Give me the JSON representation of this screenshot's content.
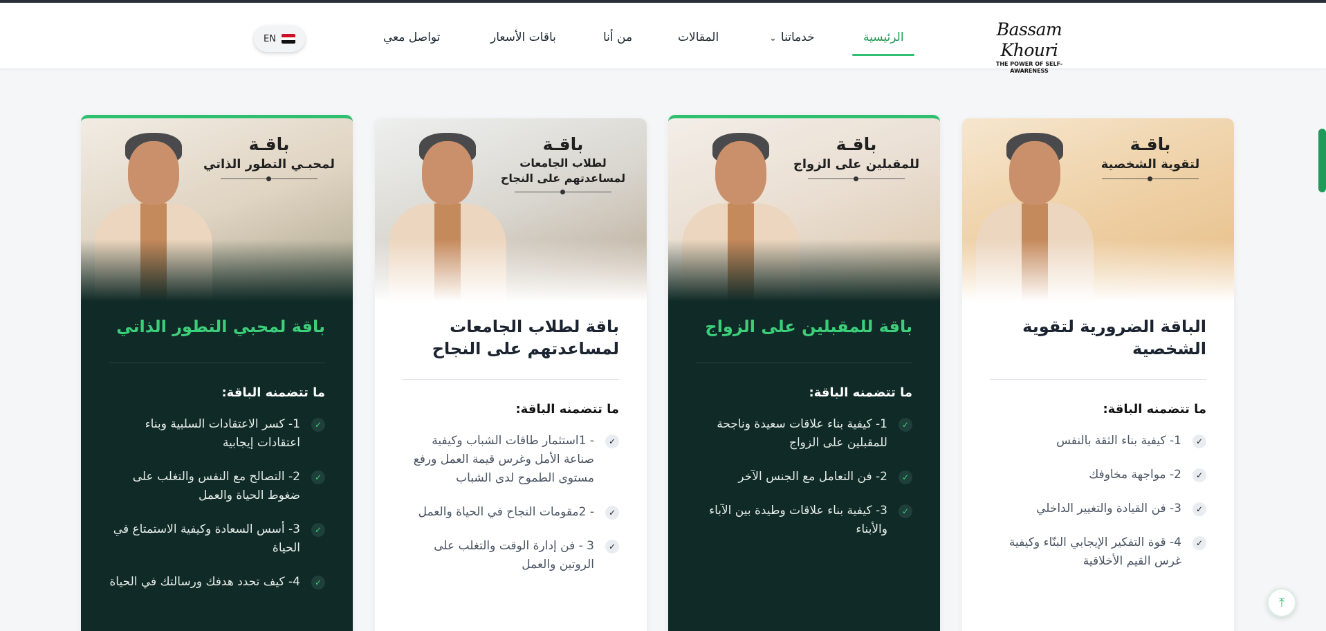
{
  "header": {
    "logo_script": "Bassam Khouri",
    "logo_tagline": "THE POWER OF SELF-AWARENESS",
    "nav": {
      "home": "الرئيسية",
      "services": "خدماتنا",
      "articles": "المقالات",
      "about": "من أنا",
      "pricing": "باقات الأسعار",
      "contact": "تواصل معي"
    },
    "lang_label": "EN"
  },
  "cards": [
    {
      "overlay_title": "باقـة",
      "overlay_sub": "لتقوية الشخصية",
      "title": "الباقة الضرورية لتقوية الشخصية",
      "includes": "ما تتضمنه الباقة:",
      "features": [
        "1- كيفية بناء الثقة بالنفس",
        "2- مواجهة مخاوفك",
        "3- فن القيادة والتغيير الداخلي",
        "4- قوة التفكير الإيجابي البنّاء وكيفية غرس القيم الأخلاقية"
      ]
    },
    {
      "overlay_title": "باقـة",
      "overlay_sub": "للمقبلين على الزواج",
      "title": "باقة للمقبلين على الزواج",
      "includes": "ما تتضمنه الباقة:",
      "features": [
        "1- كيفية بناء علاقات سعيدة وناجحة للمقبلين على الزواج",
        "2- فن التعامل مع الجنس الآخر",
        "3- كيفية بناء علاقات وطيدة بين الآباء والأبناء"
      ]
    },
    {
      "overlay_title": "باقـة",
      "overlay_sub": "لطلاب الجامعات لمساعدتهم على النجاح",
      "title": "باقة لطلاب الجامعات لمساعدتهم على النجاح",
      "includes": "ما تتضمنه الباقة:",
      "features": [
        "- 1استثمار طاقات الشباب وكيفية صناعة الأمل وغرس قيمة العمل ورفع مستوى الطموح لدى الشباب",
        "- 2مقومات النجاح في الحياة والعمل",
        "3 - فن إدارة الوقت والتغلب على الروتين والعمل"
      ]
    },
    {
      "overlay_title": "باقـة",
      "overlay_sub": "لمحبـي التطور الذاتي",
      "title": "باقة لمحبي التطور الذاتي",
      "includes": "ما تتضمنه الباقة:",
      "features": [
        "1- كسر الاعتقادات السلبية وبناء اعتقادات إيجابية",
        "2- التصالح مع النفس والتغلب على ضغوط الحياة والعمل",
        "3- أسس السعادة وكيفية الاستمتاع في الحياة",
        "4- كيف تحدد هدفك ورسالتك في الحياة"
      ]
    }
  ],
  "colors": {
    "accent": "#2fbf71",
    "dark_card": "#0f2a27",
    "dark_title": "#3ccf7a"
  },
  "icons": {
    "check": "check-icon",
    "chevron": "chevron-down-icon",
    "back_to_top": "arrow-up-icon"
  }
}
